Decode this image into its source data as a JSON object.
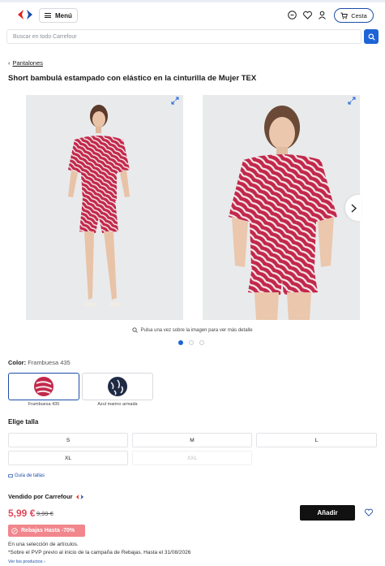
{
  "header": {
    "menu_label": "Menú",
    "cart_label": "Cesta",
    "brand_colors": {
      "blue": "#1d4ea8",
      "red": "#e2231a"
    }
  },
  "search": {
    "placeholder": "Buscar en todo Carrefour"
  },
  "breadcrumb": {
    "label": "Pantalones"
  },
  "product": {
    "title": "Short bambulá estampado con elástico en la cinturilla de Mujer TEX",
    "zoom_hint": "Pulsa una vez sobre la imagen para ver más detalle",
    "gallery_count": 3,
    "gallery_active": 1,
    "color_label": "Color:",
    "color_value": "Frambuesa 435",
    "swatches": [
      {
        "name": "Frambuesa 435",
        "selected": true
      },
      {
        "name": "Azul marino armada",
        "selected": false
      }
    ],
    "size_label": "Elige talla",
    "sizes": [
      {
        "label": "S",
        "available": true
      },
      {
        "label": "M",
        "available": true
      },
      {
        "label": "L",
        "available": true
      },
      {
        "label": "XL",
        "available": true
      },
      {
        "label": "XXL",
        "available": false
      }
    ],
    "size_guide": "Guía de tallas"
  },
  "purchase": {
    "sold_by": "Vendido por Carrefour",
    "price": "5,99 €",
    "old_price": "9,99 €",
    "add_label": "Añadir",
    "promo_label": "Rebajas Hasta -70%",
    "note_1": "En una selección de artículos.",
    "note_2": "*Sobre el PVP previo al inicio de la campaña de Rebajas. Hasta el 31/08/2026",
    "more_link": "Ver los productos"
  },
  "colors": {
    "accent": "#1d64d6",
    "price_red": "#e0475b",
    "promo_pink": "#f1868c",
    "garment": "#c2284a"
  }
}
